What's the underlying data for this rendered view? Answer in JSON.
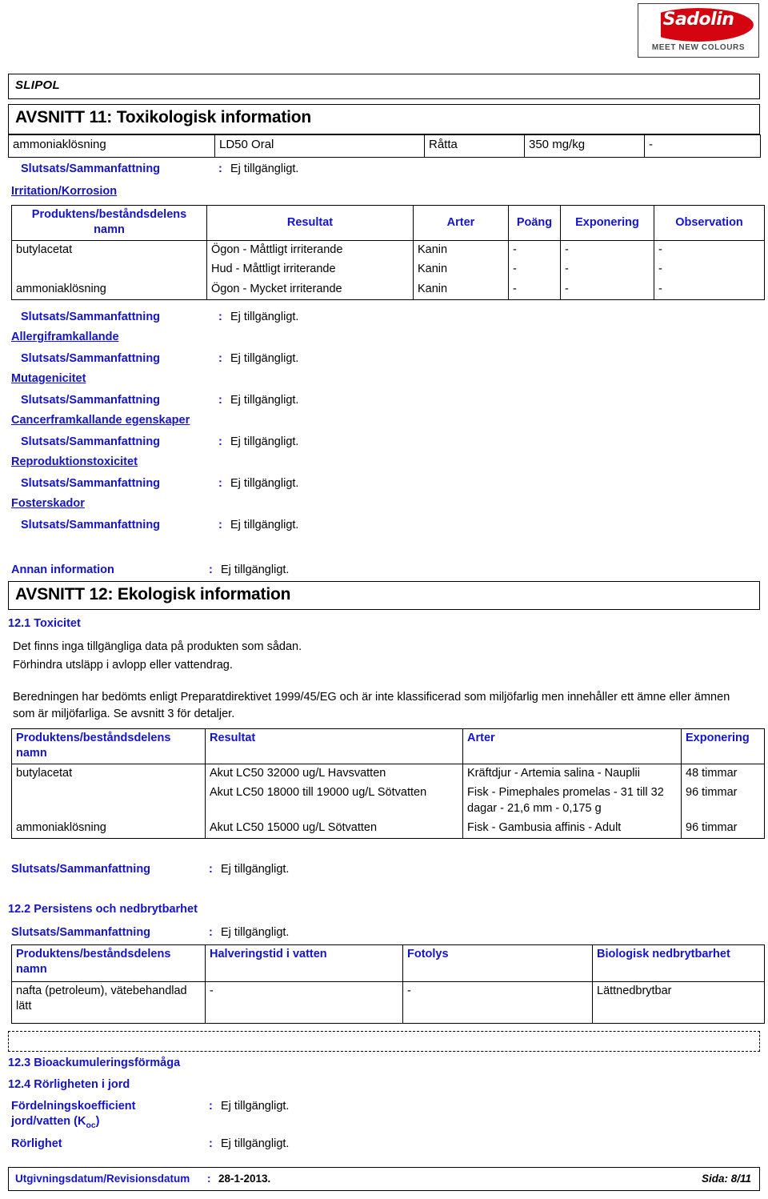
{
  "brand": {
    "logo_word": "Sadolin",
    "logo_tagline": "MEET NEW COLOURS",
    "logo_color": "#d40511"
  },
  "accent_blue": "#1414c8",
  "product_name": "SLIPOL",
  "sections": {
    "s11_title": "AVSNITT 11: Toxikologisk information",
    "s12_title": "AVSNITT 12: Ekologisk information"
  },
  "not_available": "Ej tillgängligt.",
  "colon": ":",
  "labels": {
    "conclusion_summary": "Slutsats/Sammanfattning",
    "other_information": "Annan information",
    "irritation_corrosion": "Irritation/Korrosion",
    "sensitisation": "Allergiframkallande",
    "mutagenicity": "Mutagenicitet",
    "carcinogenicity": "Cancerframkallande egenskaper",
    "reproductive_toxicity": "Reproduktionstoxicitet",
    "teratogenicity": "Fosterskador",
    "s12_1": "12.1 Toxicitet",
    "s12_2": "12.2 Persistens och nedbrytbarhet",
    "s12_3": "12.3 Bioackumuleringsförmåga",
    "s12_4": "12.4 Rörligheten i jord",
    "partition_coefficient_line1": "Fördelningskoefficient",
    "partition_coefficient_line2_a": "jord/vatten (K",
    "partition_coefficient_line2_sub": "oc",
    "partition_coefficient_line2_b": ")",
    "mobility": "Rörlighet"
  },
  "acute_tox_table": {
    "row": {
      "name": "ammoniaklösning",
      "result": "LD50 Oral",
      "species": "Råtta",
      "dose": "350 mg/kg",
      "exposure": "-"
    }
  },
  "irritation_table": {
    "headers": [
      "Produktens/beståndsdelens namn",
      "Resultat",
      "Arter",
      "Poäng",
      "Exponering",
      "Observation"
    ],
    "rows": [
      {
        "name": "butylacetat",
        "result": "Ögon - Måttligt irriterande",
        "species": "Kanin",
        "score": "-",
        "exposure": "-",
        "observation": "-"
      },
      {
        "name": "",
        "result": "Hud - Måttligt irriterande",
        "species": "Kanin",
        "score": "-",
        "exposure": "-",
        "observation": "-"
      },
      {
        "name": "ammoniaklösning",
        "result": "Ögon - Mycket irriterande",
        "species": "Kanin",
        "score": "-",
        "exposure": "-",
        "observation": "-"
      }
    ]
  },
  "toxicity_intro": {
    "line1": "Det finns inga tillgängliga data på produkten som sådan.",
    "line2": "Förhindra utsläpp i avlopp eller vattendrag.",
    "paragraph": "Beredningen har bedömts enligt Preparatdirektivet 1999/45/EG och är inte klassificerad som miljöfarlig men innehåller ett ämne eller ämnen som är miljöfarliga. Se avsnitt 3 för detaljer."
  },
  "ecotox_table": {
    "headers": [
      "Produktens/beståndsdelens namn",
      "Resultat",
      "Arter",
      "Exponering"
    ],
    "rows": [
      {
        "name": "butylacetat",
        "result": "Akut LC50 32000 ug/L Havsvatten",
        "species": "Kräftdjur - Artemia salina - Nauplii",
        "exposure": "48 timmar"
      },
      {
        "name": "",
        "result": "Akut LC50 18000 till 19000 ug/L Sötvatten",
        "species": "Fisk - Pimephales promelas - 31 till 32 dagar - 21,6 mm - 0,175 g",
        "exposure": "96 timmar"
      },
      {
        "name": "ammoniaklösning",
        "result": "Akut LC50 15000 ug/L Sötvatten",
        "species": "Fisk - Gambusia affinis - Adult",
        "exposure": "96 timmar"
      }
    ]
  },
  "persistence_table": {
    "headers": [
      "Produktens/beståndsdelens namn",
      "Halveringstid i vatten",
      "Fotolys",
      "Biologisk nedbrytbarhet"
    ],
    "rows": [
      {
        "name": "nafta (petroleum), vätebehandlad lätt",
        "half_life": "-",
        "photolysis": "-",
        "biodegradability": "Lättnedbrytbar"
      }
    ]
  },
  "footer": {
    "label": "Utgivningsdatum/Revisionsdatum",
    "date": "28-1-2013.",
    "page": "Sida: 8/11"
  }
}
